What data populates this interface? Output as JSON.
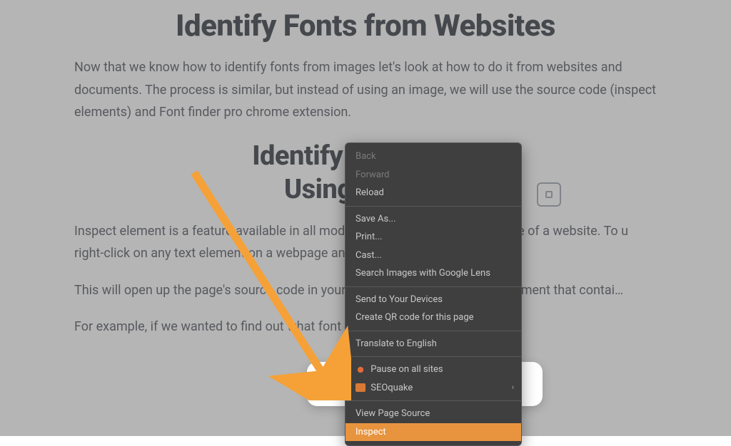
{
  "heading1": "Identify Fonts from Websites",
  "para1": "Now that we know how to identify fonts from images let's look at how to do it from websites and documents. The process is similar, but instead of using an image, we will use the source code (inspect elements) and Font finder pro chrome extension.",
  "heading2_line1": "Identify Fonts from",
  "heading2_line2": "Using Inspect",
  "para2": "Inspect element is a feature available in all mode                                         view and edit the source code of a website. To u                                          right-click on any text element on a webpage and                                          drop-down menu.",
  "para3": "This will open up the page's source code in your                                           through it until you find the element that contai…",
  "para4": "For example, if we wanted to find out what font is used for the heading on this",
  "context_menu": {
    "group1": [
      "Back",
      "Forward",
      "Reload"
    ],
    "group2": [
      "Save As...",
      "Print...",
      "Cast...",
      "Search Images with Google Lens"
    ],
    "group3": [
      "Send to Your Devices",
      "Create QR code for this page"
    ],
    "group4": [
      "Translate to English"
    ],
    "group5_pause": "Pause on all sites",
    "group5_seoq": "SEOquake",
    "group6_vps": "View Page Source",
    "group6_inspect": "Inspect"
  }
}
